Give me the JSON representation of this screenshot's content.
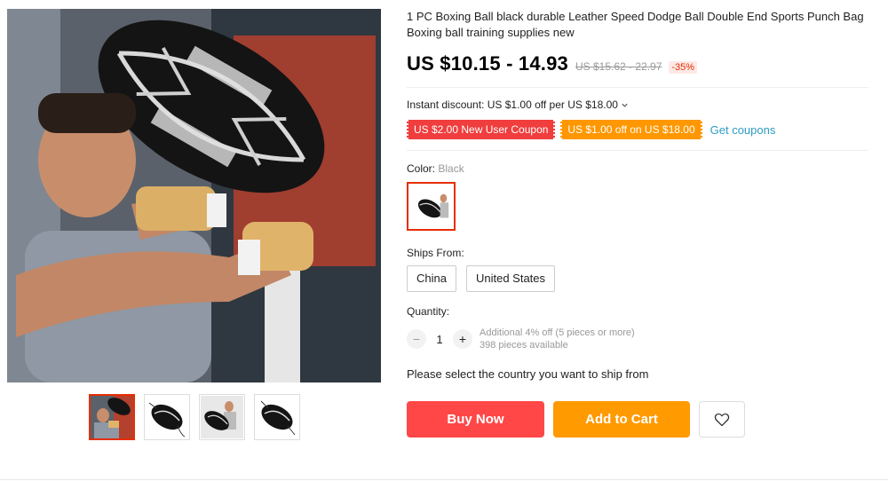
{
  "product": {
    "title": "1 PC Boxing Ball black durable Leather Speed Dodge Ball Double End Sports Punch Bag Boxing ball training supplies new",
    "price": "US $10.15 - 14.93",
    "original_price": "US $15.62 - 22.97",
    "discount": "-35%",
    "instant_discount": "Instant discount: US $1.00 off per US $18.00",
    "chevron_icon": "chevron-down-icon"
  },
  "coupons": [
    {
      "label": "US $2.00 New User Coupon",
      "color": "#f03d3d"
    },
    {
      "label": "US $1.00 off on US $18.00",
      "color": "#ff9700"
    }
  ],
  "get_coupons_label": "Get coupons",
  "color": {
    "label": "Color:",
    "selected": "Black"
  },
  "ships_from": {
    "label": "Ships From:",
    "options": [
      "China",
      "United States"
    ]
  },
  "quantity": {
    "label": "Quantity:",
    "value": "1",
    "minus": "−",
    "plus": "+",
    "note_line1": "Additional 4% off (5 pieces or more)",
    "note_line2": "398 pieces available"
  },
  "country_message": "Please select the country you want to ship from",
  "actions": {
    "buy_now": "Buy Now",
    "add_to_cart": "Add to Cart",
    "wishlist_icon": "heart-icon"
  },
  "gallery": {
    "thumbnail_count": 4,
    "selected_index": 0
  },
  "colors": {
    "accent_red": "#ff4747",
    "accent_orange": "#ff9a00",
    "link": "#2e9cc3",
    "selected_border": "#e62e04"
  }
}
